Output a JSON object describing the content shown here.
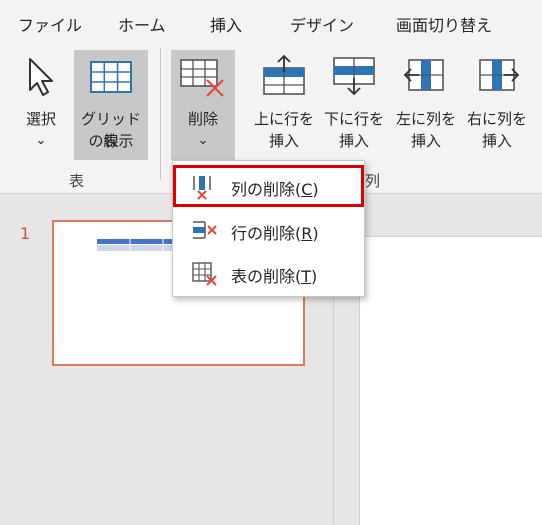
{
  "tabs": [
    "ファイル",
    "ホーム",
    "挿入",
    "デザイン",
    "画面切り替え"
  ],
  "ribbon": {
    "select": {
      "line1": "選択",
      "chevron": "⌄"
    },
    "gridlines": {
      "line1": "グリッド線",
      "line2": "の表示"
    },
    "group_table": "表",
    "delete": {
      "line1": "削除",
      "chevron": "⌄"
    },
    "insert_above": {
      "line1": "上に行を",
      "line2": "挿入"
    },
    "insert_below": {
      "line1": "下に行を",
      "line2": "挿入"
    },
    "insert_left": {
      "line1": "左に列を",
      "line2": "挿入"
    },
    "insert_right": {
      "line1": "右に列を",
      "line2": "挿入"
    },
    "group_rowscols_partial": "列"
  },
  "slide_panel": {
    "slide_number": "1"
  },
  "delete_menu": {
    "items": [
      {
        "label": "列の削除(",
        "key": "C",
        "close": ")",
        "icon": "delete-column-icon"
      },
      {
        "label": "行の削除(",
        "key": "R",
        "close": ")",
        "icon": "delete-row-icon"
      },
      {
        "label": "表の削除(",
        "key": "T",
        "close": ")",
        "icon": "delete-table-icon"
      }
    ]
  },
  "colors": {
    "accent_blue": "#2e75b6",
    "delete_red": "#e04a3a",
    "highlight_red": "#e00000",
    "thumb_border": "#e07a5f"
  }
}
